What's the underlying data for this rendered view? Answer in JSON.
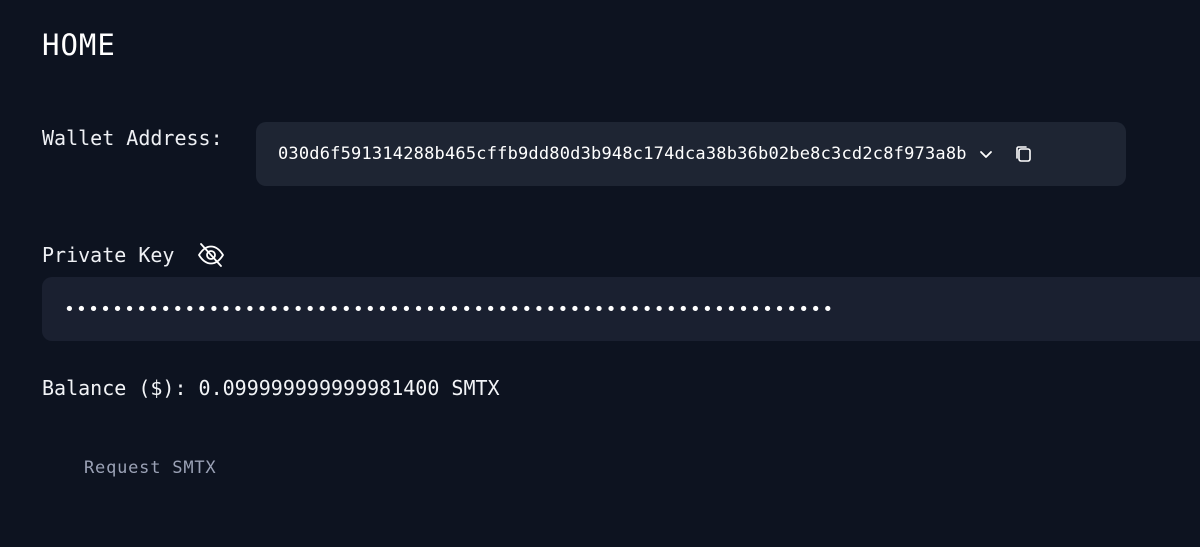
{
  "page": {
    "title": "HOME"
  },
  "wallet": {
    "label": "Wallet Address:",
    "address": "030d6f591314288b465cffb9dd80d3b948c174dca38b36b02be8c3cd2c8f973a8b",
    "dropdown_icon": "chevron-down-icon",
    "copy_icon": "copy-icon"
  },
  "private_key": {
    "label": "Private Key",
    "visibility_icon": "eye-off-icon",
    "masked_value": "••••••••••••••••••••••••••••••••••••••••••••••••••••••••••••••••"
  },
  "balance": {
    "label": "Balance ($):",
    "amount": "0.099999999999981400",
    "unit": "SMTX"
  },
  "actions": {
    "request_label": "Request SMTX"
  },
  "colors": {
    "background": "#0d1320",
    "field_background": "#1e2533",
    "text": "#f2f4f7",
    "muted_text": "#9aa1b5"
  }
}
